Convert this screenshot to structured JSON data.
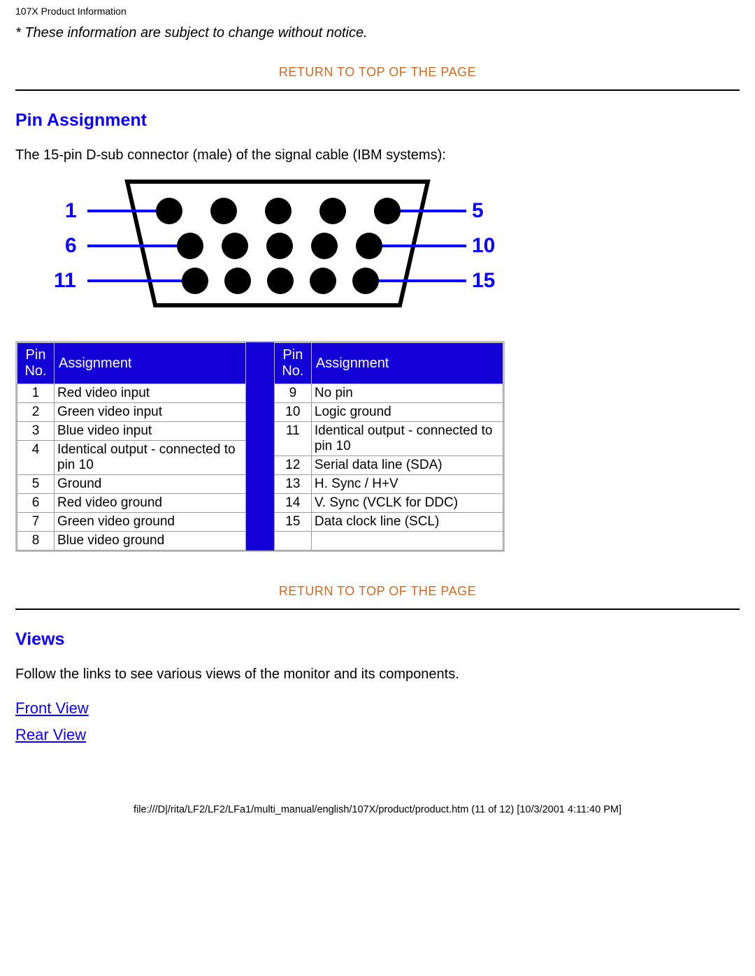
{
  "header": {
    "title": "107X Product Information"
  },
  "notice": "* These information are subject to change without notice.",
  "links": {
    "return_top": "RETURN TO TOP OF THE PAGE",
    "front_view": "Front View",
    "rear_view": "Rear View"
  },
  "sections": {
    "pin_assignment_title": "Pin Assignment",
    "pin_assignment_text": "The 15-pin D-sub connector (male) of the signal cable (IBM systems):",
    "views_title": "Views",
    "views_text": "Follow the links to see various views of the monitor and its components."
  },
  "dsub_labels": {
    "l1": "1",
    "r1": "5",
    "l2": "6",
    "r2": "10",
    "l3": "11",
    "r3": "15"
  },
  "pin_table": {
    "header_pin": "Pin No.",
    "header_assign": "Assignment",
    "left": [
      {
        "pin": "1",
        "assign": "Red video input"
      },
      {
        "pin": "2",
        "assign": "Green video input"
      },
      {
        "pin": "3",
        "assign": "Blue video input"
      },
      {
        "pin": "4",
        "assign": "Identical output - connected to pin 10"
      },
      {
        "pin": "5",
        "assign": "Ground"
      },
      {
        "pin": "6",
        "assign": "Red video ground"
      },
      {
        "pin": "7",
        "assign": "Green video ground"
      },
      {
        "pin": "8",
        "assign": "Blue video ground"
      }
    ],
    "right": [
      {
        "pin": "9",
        "assign": "No pin"
      },
      {
        "pin": "10",
        "assign": "Logic ground"
      },
      {
        "pin": "11",
        "assign": "Identical output - connected to pin 10"
      },
      {
        "pin": "12",
        "assign": "Serial data line (SDA)"
      },
      {
        "pin": "13",
        "assign": "H. Sync / H+V"
      },
      {
        "pin": "14",
        "assign": "V. Sync (VCLK for DDC)"
      },
      {
        "pin": "15",
        "assign": "Data clock line (SCL)"
      },
      {
        "pin": "",
        "assign": ""
      }
    ]
  },
  "footer": "file:///D|/rita/LF2/LF2/LFa1/multi_manual/english/107X/product/product.htm (11 of 12) [10/3/2001 4:11:40 PM]"
}
